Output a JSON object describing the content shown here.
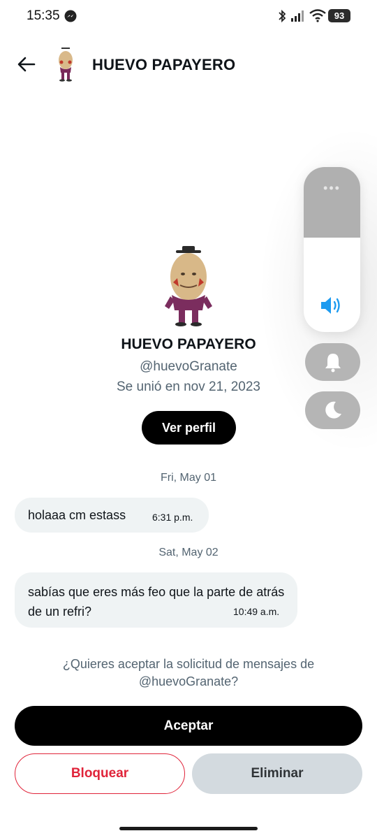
{
  "status_bar": {
    "time": "15:35",
    "battery": "93"
  },
  "header": {
    "title": "HUEVO PAPAYERO"
  },
  "profile": {
    "name": "HUEVO PAPAYERO",
    "handle": "@huevoGranate",
    "joined": "Se unió en nov 21, 2023",
    "view_profile_label": "Ver perfil"
  },
  "messages": [
    {
      "date": "Fri, May 01",
      "text": "holaaa cm estass",
      "time": "6:31 p.m."
    },
    {
      "date": "Sat, May 02",
      "text": "sabías que eres más feo que la parte de atrás de un refri?",
      "time": "10:49 a.m."
    }
  ],
  "request": {
    "prompt": "¿Quieres aceptar la solicitud de mensajes de @huevoGranate?",
    "accept_label": "Aceptar",
    "block_label": "Bloquear",
    "delete_label": "Eliminar"
  },
  "volume_overlay": {
    "more_label": "•••",
    "level": 0.57
  },
  "colors": {
    "accent_blue": "#1d9bf0",
    "danger_red": "#e0243a",
    "bubble_bg": "#eff3f4",
    "muted_text": "#536471"
  }
}
